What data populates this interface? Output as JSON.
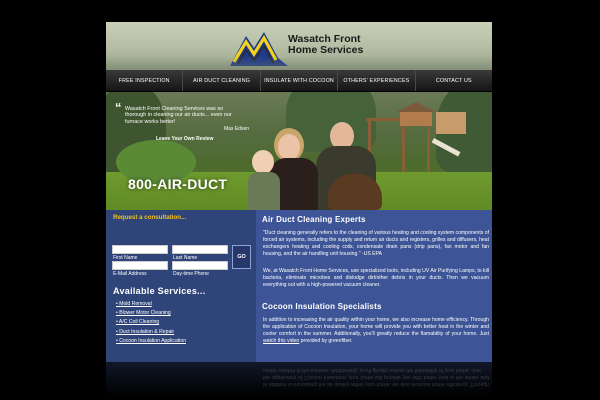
{
  "brand": {
    "name_line1": "Wasatch Front",
    "name_line2": "Home Services"
  },
  "nav": [
    {
      "label": "FREE INSPECTION"
    },
    {
      "label": "AIR DUCT CLEANING"
    },
    {
      "label": "INSULATE WITH COCOON"
    },
    {
      "label": "OTHERS' EXPERIENCES"
    },
    {
      "label": "CONTACT US"
    }
  ],
  "hero": {
    "quote": "Wasatch Front Cleaning Services was so thorough in cleaning our air ducts... even our furnace works better!",
    "author": "Max Edsen",
    "review_link": "Leave Your Own Review",
    "phone": "800-AIR-DUCT"
  },
  "consult": {
    "title": "Request a consultation...",
    "first_name": "First Name",
    "last_name": "Last Name",
    "email": "E-Mail Address",
    "phone": "Day-time Phone",
    "go": "GO"
  },
  "services": {
    "title": "Available Services...",
    "items": [
      "• Mold Removal",
      "• Blower Motor Cleaning",
      "• A/C Coil Cleaning",
      "• Duct Insulation & Repair",
      "• Cocoon Insulation Application"
    ]
  },
  "content": {
    "heading1": "Air Duct Cleaning Experts",
    "para1": "\"Duct cleaning generally refers to the cleaning of various heating and cooling system components of forced air systems, including the supply and return air ducts and registers, grilles and diffusers, heat exchangers heating and cooling coils, condensate drain pans (drip pans), fan motor and fan housing, and the air handling unit housing.\" -US EPA",
    "para2": "We, at Wasatch Front Home Services, use specialized tools, including UV Air Purifying Lamps, to kill bacteria, eliminate microbes and dislodge dirt/other debris in your ducts. Then we vacuum everything out with a high-powered vacuum cleaner.",
    "heading2": "Cocoon Insulation Specialists",
    "para3_before": "In addition to increasing the air quality within your home, we also increase home efficiency. Through the application of Cocoon Insulation, your home will provide you with better heat in the winter and cooler comfort in the summer. Additionally, you'll greatly reduce the flamability of your home. Just ",
    "para3_link": "watch this video",
    "para3_after": " provided by greenfiber."
  },
  "colors": {
    "page_bg": "#000000",
    "content_bg": "#3d5596",
    "left_bg": "#2f4479",
    "accent_yellow": "#f4c21d",
    "nav_bg": "#1e1e1e"
  }
}
